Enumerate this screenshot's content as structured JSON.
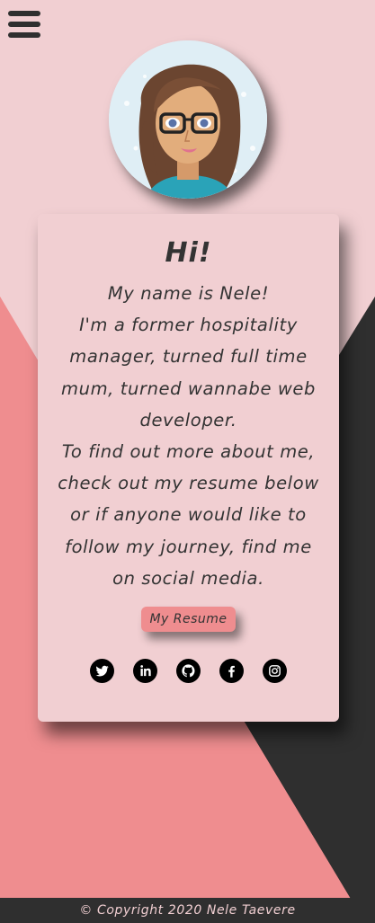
{
  "colors": {
    "background_pink": "#f1cfd2",
    "coral": "#ef8d8f",
    "dark": "#2f2f2f"
  },
  "header": {
    "menu_icon": "hamburger-menu-icon"
  },
  "profile": {
    "avatar_icon": "cartoon-avatar-woman-glasses"
  },
  "card": {
    "greeting": "Hi!",
    "bio_lines": [
      "My name is Nele!",
      "I'm a former hospitality manager, turned full time mum, turned wannabe web developer.",
      "To find out more about me, check out my resume below or if anyone would like to follow my journey, find me on social media."
    ],
    "resume_label": "My Resume",
    "socials": [
      {
        "name": "twitter-icon"
      },
      {
        "name": "linkedin-icon"
      },
      {
        "name": "github-icon"
      },
      {
        "name": "facebook-icon"
      },
      {
        "name": "instagram-icon"
      }
    ]
  },
  "footer": {
    "copyright": "© Copyright 2020 Nele Taevere"
  }
}
